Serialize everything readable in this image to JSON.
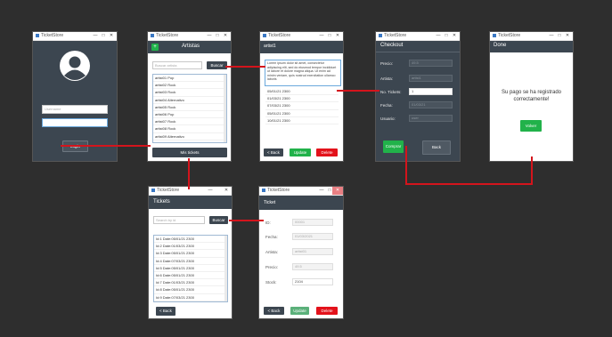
{
  "app_title": "TicketStore",
  "window_controls": {
    "minimize": "—",
    "maximize": "□",
    "close": "✕"
  },
  "login": {
    "username_placeholder": "Username",
    "password_placeholder": "",
    "login_button": "Login"
  },
  "artists": {
    "title": "Artistas",
    "add_button": "+",
    "search_placeholder": "Buscar artista",
    "search_button": "Buscar",
    "items": [
      "artist01 Pop",
      "artist02 Rock",
      "artist03 Rock",
      "artist04 Alternativo",
      "artist05 Rock",
      "artist06 Pop",
      "artist07 Rock",
      "artist08 Rock",
      "artist09 Alternativo"
    ],
    "my_tickets_button": "Mis tickets"
  },
  "artist_detail": {
    "title": "artist1",
    "description": "Lorem ipsum dolor sit amet, consectetur adipiscing elit, sed do eiusmod tempor incididunt ut labore et dolore magna aliqua. Ut enim ad minim veniam, quis nostrud exercitation ullamco laboris",
    "dates": [
      "05/01/21 2300",
      "01/03/21 2300",
      "07/03/21 2300",
      "05/01/21 2300",
      "10/01/21 2300"
    ],
    "back_button": "< Back",
    "update_button": "Update",
    "delete_button": "Delete"
  },
  "checkout": {
    "title": "Checkout",
    "fields": [
      {
        "label": "Precio:",
        "value": "49.5"
      },
      {
        "label": "Artista:",
        "value": "artist1"
      },
      {
        "label": "No. Tickets:",
        "value": "1"
      },
      {
        "label": "Fecha:",
        "value": "01/03/21"
      },
      {
        "label": "Usuario:",
        "value": "user"
      }
    ],
    "buy_button": "Comprar",
    "back_button": "Back"
  },
  "done": {
    "title": "Done",
    "message": "Su pago se ha registrado correctamente!",
    "volver_button": "Volver"
  },
  "tickets": {
    "title": "Tickets",
    "search_placeholder": "Search by id",
    "search_button": "Buscar",
    "items": [
      "Id:1 Date:05/01/21 2300",
      "Id:2 Date:01/03/21 2300",
      "Id:3 Date:05/01/21 2300",
      "Id:4 Date:07/03/21 2300",
      "Id:5 Date:05/01/21 2300",
      "Id:6 Date:05/01/21 2300",
      "Id:7 Date:01/03/21 2300",
      "Id:8 Date:05/01/21 2300",
      "Id:9 Date:07/03/21 2300",
      "Id:10 Date:05/01/21 2300"
    ],
    "back_button": "< Back"
  },
  "ticket": {
    "title": "Ticket",
    "fields": [
      {
        "label": "ID:",
        "value": "00001"
      },
      {
        "label": "Fecha:",
        "value": "01/03/2021"
      },
      {
        "label": "Artista:",
        "value": "artist01"
      },
      {
        "label": "Precio:",
        "value": "49.5"
      },
      {
        "label": "Stock:",
        "value": "2104"
      }
    ],
    "back_button": "< Back",
    "update_button": "Update",
    "delete_button": "Delete"
  },
  "colors": {
    "header": "#3c4650",
    "accent_green": "#21b24a",
    "accent_red": "#e3121b",
    "connector": "#d4141c"
  }
}
